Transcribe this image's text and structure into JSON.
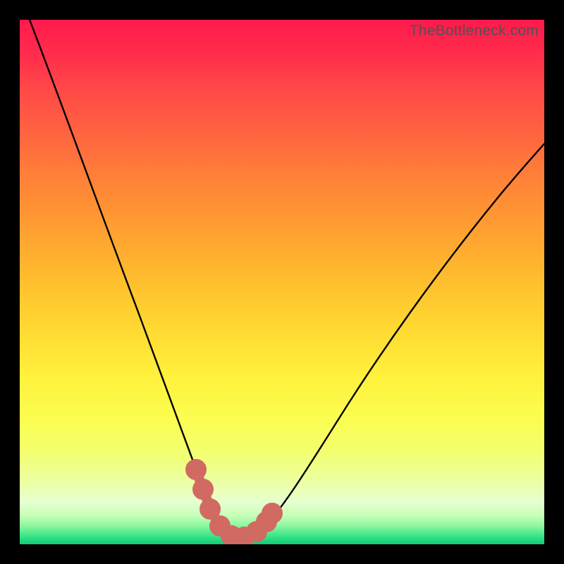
{
  "watermark": "TheBottleneck.com",
  "chart_data": {
    "type": "line",
    "title": "",
    "xlabel": "",
    "ylabel": "",
    "xlim": [
      0,
      100
    ],
    "ylim": [
      0,
      100
    ],
    "grid": false,
    "series": [
      {
        "name": "bottleneck-curve",
        "color": "#000000",
        "x": [
          2,
          5,
          8,
          11,
          14,
          17,
          20,
          23,
          26,
          29,
          31,
          33,
          35,
          36.5,
          38,
          40,
          43,
          47,
          51,
          55,
          60,
          66,
          72,
          78,
          85,
          92,
          100
        ],
        "y": [
          100,
          92,
          84,
          76,
          68,
          60,
          52,
          44,
          36,
          28,
          22,
          16,
          10,
          6,
          3,
          1.5,
          1.5,
          3,
          7,
          12,
          19,
          27,
          35,
          43,
          51,
          59,
          67
        ]
      },
      {
        "name": "highlight-segment",
        "color": "#d16a62",
        "x": [
          33,
          34.5,
          36,
          37.5,
          39,
          41,
          43,
          45,
          46.5,
          47.5
        ],
        "y": [
          14,
          10,
          6,
          3.5,
          2,
          1.5,
          1.5,
          2.5,
          4,
          6
        ]
      }
    ],
    "background_gradient": {
      "top": "#ff1a4d",
      "mid_high": "#ff9333",
      "mid": "#ffdc32",
      "mid_low": "#fbfd50",
      "low1": "#ecffa1",
      "low2": "#8cf7a0",
      "bottom": "#15c978"
    }
  }
}
